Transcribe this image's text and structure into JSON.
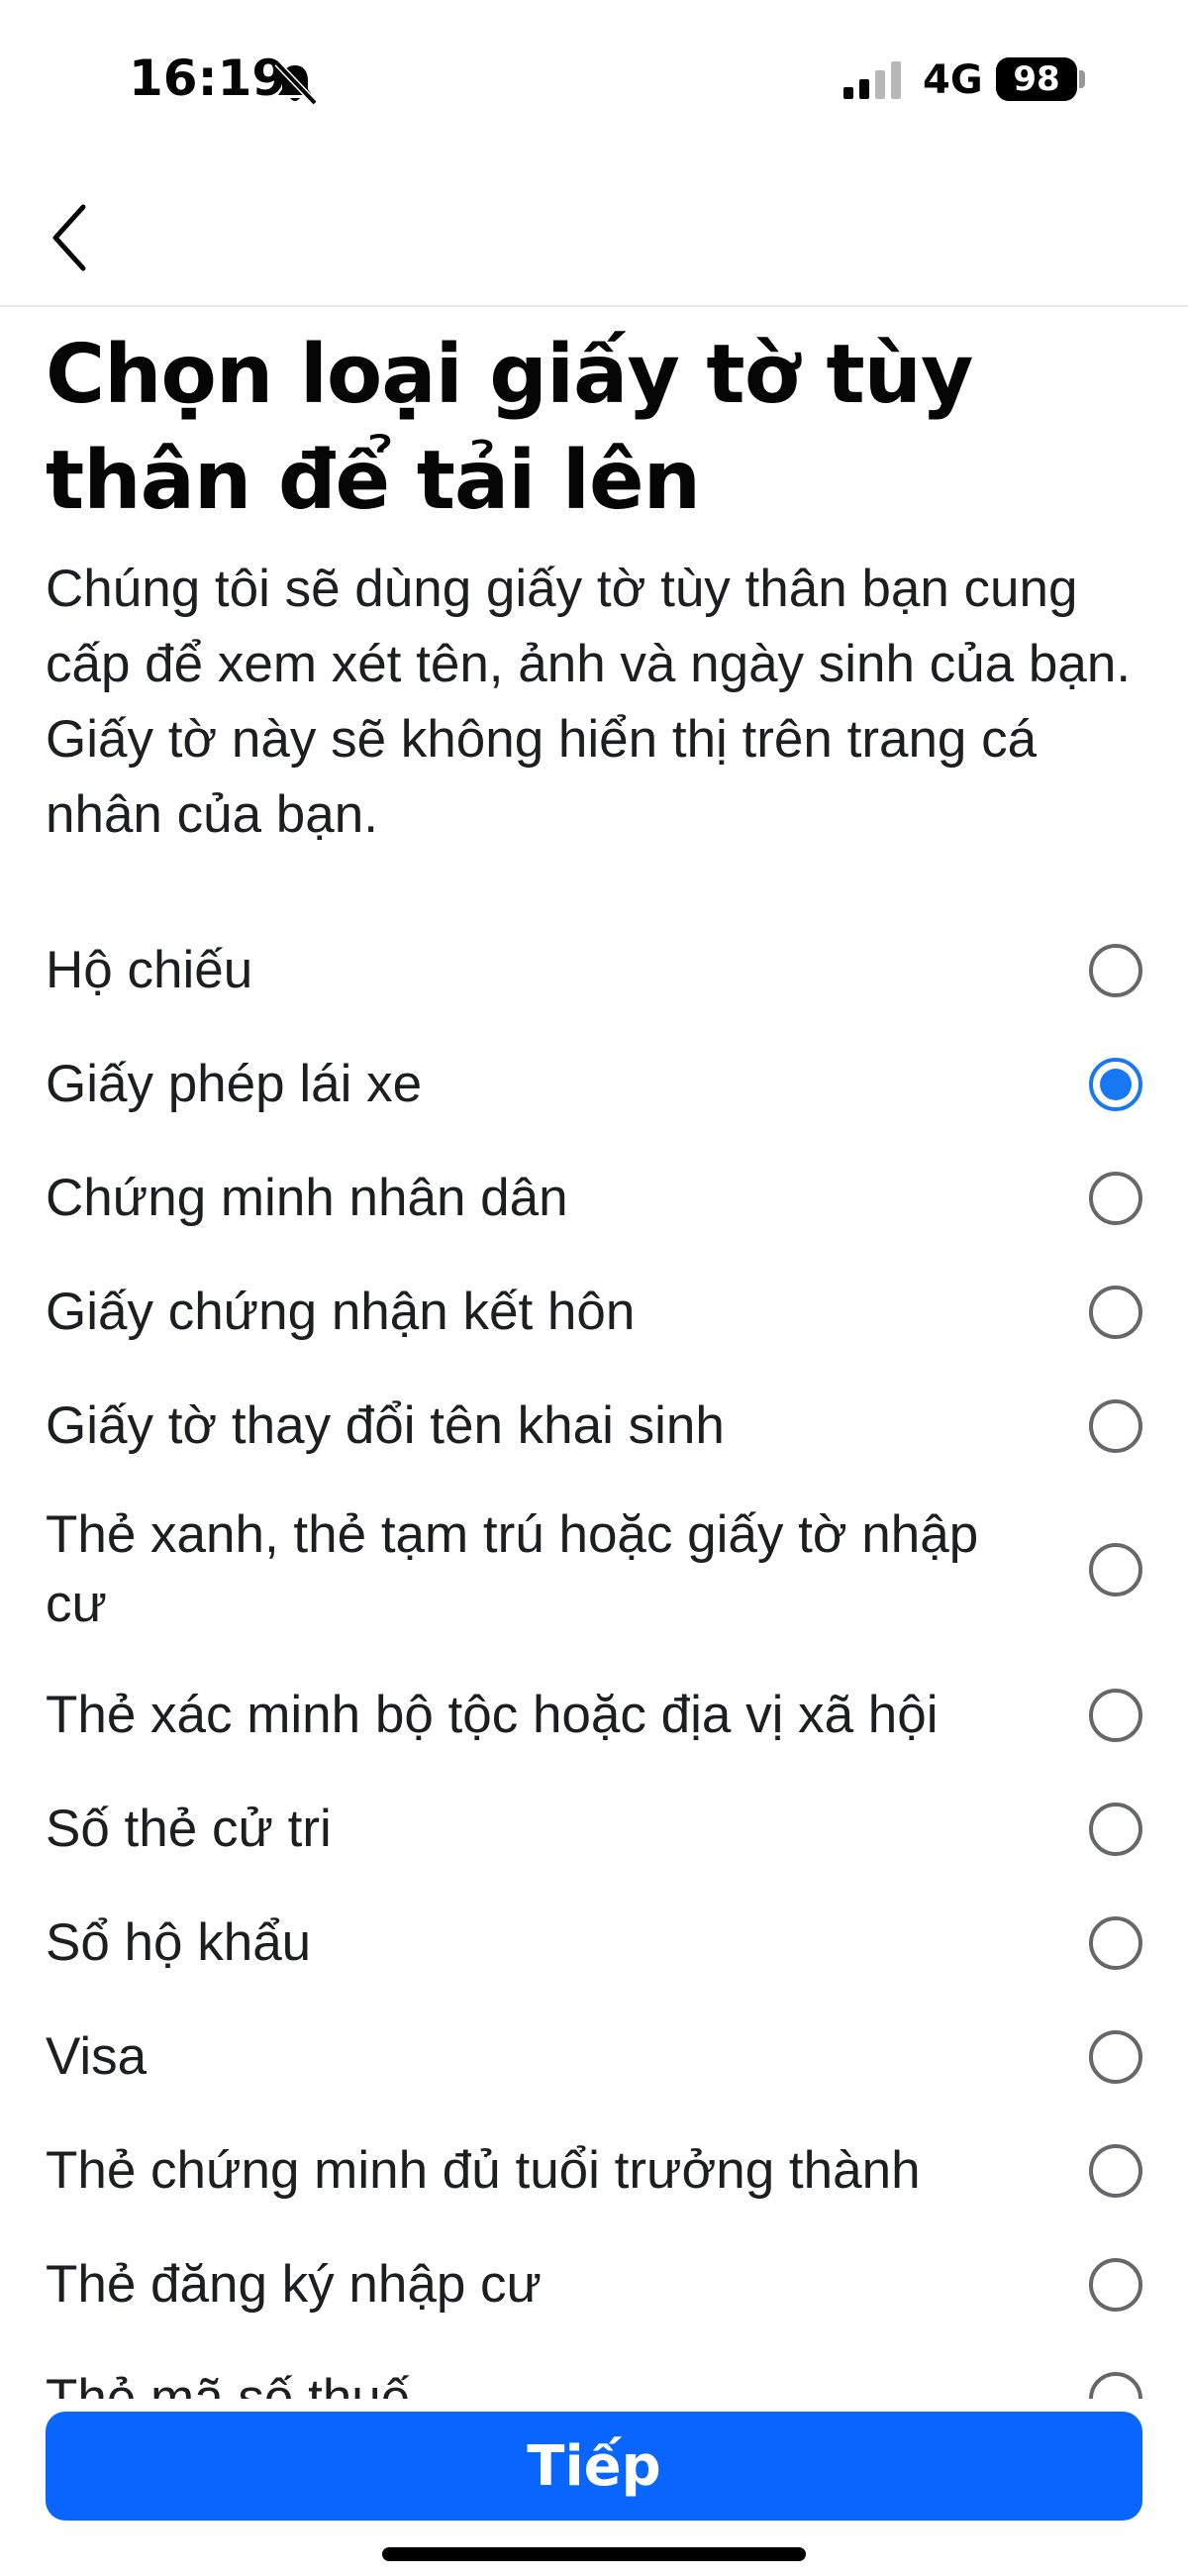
{
  "status_bar": {
    "time": "16:19",
    "network": "4G",
    "battery": "98",
    "icons": [
      "bell-muted-icon",
      "signal-icon",
      "battery-icon"
    ]
  },
  "nav": {
    "back_icon": "chevron-left-icon"
  },
  "header": {
    "title": "Chọn loại giấy tờ tùy thân để tải lên",
    "description": "Chúng tôi sẽ dùng giấy tờ tùy thân bạn cung cấp để xem xét tên, ảnh và ngày sinh của bạn. Giấy tờ này sẽ không hiển thị trên trang cá nhân của bạn."
  },
  "options": [
    {
      "label": "Hộ chiếu",
      "selected": false
    },
    {
      "label": "Giấy phép lái xe",
      "selected": true
    },
    {
      "label": "Chứng minh nhân dân",
      "selected": false
    },
    {
      "label": "Giấy chứng nhận kết hôn",
      "selected": false
    },
    {
      "label": "Giấy tờ thay đổi tên khai sinh",
      "selected": false
    },
    {
      "label": "Thẻ xanh, thẻ tạm trú hoặc giấy tờ nhập cư",
      "selected": false
    },
    {
      "label": "Thẻ xác minh bộ tộc hoặc địa vị xã hội",
      "selected": false
    },
    {
      "label": "Số thẻ cử tri",
      "selected": false
    },
    {
      "label": "Sổ hộ khẩu",
      "selected": false
    },
    {
      "label": "Visa",
      "selected": false
    },
    {
      "label": "Thẻ chứng minh đủ tuổi trưởng thành",
      "selected": false
    },
    {
      "label": "Thẻ đăng ký nhập cư",
      "selected": false
    },
    {
      "label": "Thẻ mã số thuế",
      "selected": false
    }
  ],
  "footer": {
    "next_label": "Tiếp"
  },
  "colors": {
    "accent": "#0866ff",
    "radio_selected": "#1877f2",
    "radio_border": "#65676b"
  }
}
